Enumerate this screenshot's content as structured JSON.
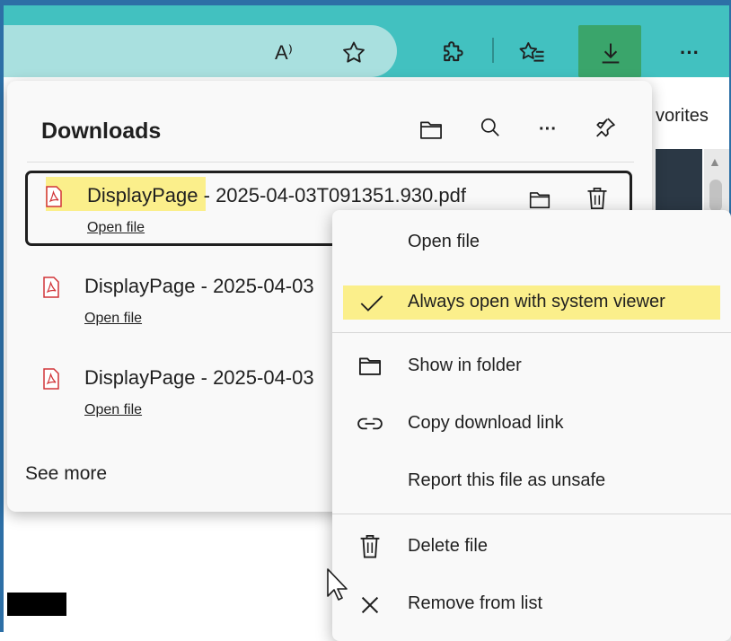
{
  "toolbar": {
    "icons": [
      "read-aloud-icon",
      "favorite-star-icon",
      "extensions-icon",
      "favorites-icon",
      "downloads-icon",
      "more-icon"
    ],
    "read_aloud_label": "A⁾",
    "more_label": "···"
  },
  "background": {
    "favorites_partial": "vorites"
  },
  "downloads": {
    "title": "Downloads",
    "header_icons": [
      "folder-icon",
      "search-icon",
      "more-icon",
      "pin-icon"
    ],
    "more_label": "···",
    "items": [
      {
        "name": "DisplayPage - 2025-04-03T091351.930.pdf",
        "action": "Open file",
        "selected": true
      },
      {
        "name": "DisplayPage - 2025-04-03",
        "action": "Open file",
        "selected": false
      },
      {
        "name": "DisplayPage - 2025-04-03",
        "action": "Open file",
        "selected": false
      }
    ],
    "see_more": "See more"
  },
  "context_menu": {
    "items": [
      {
        "label": "Open file",
        "icon": ""
      },
      {
        "label": "Always open with system viewer",
        "icon": "checkmark-icon",
        "checked": true
      },
      {
        "label": "Show in folder",
        "icon": "folder-icon"
      },
      {
        "label": "Copy download link",
        "icon": "link-icon"
      },
      {
        "label": "Report this file as unsafe",
        "icon": ""
      },
      {
        "label": "Delete file",
        "icon": "trash-icon"
      },
      {
        "label": "Remove from list",
        "icon": "close-icon"
      }
    ]
  },
  "colors": {
    "toolbar": "#42c1c0",
    "address_bar": "#a9e0df",
    "download_button_active": "#3aa56b",
    "highlight": "#fbef8b",
    "pdf_red": "#d13438"
  }
}
